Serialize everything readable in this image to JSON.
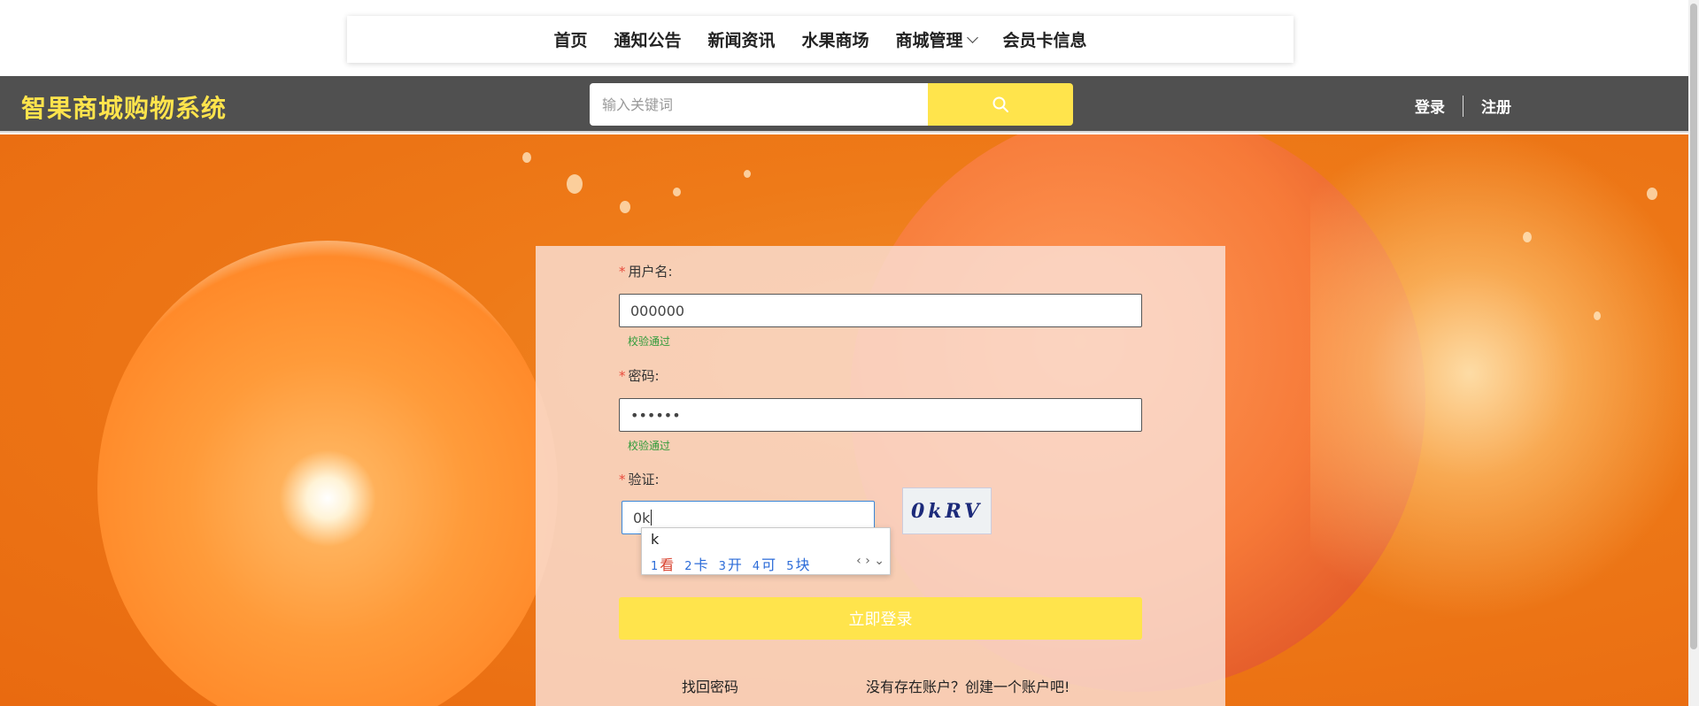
{
  "nav": {
    "items": [
      {
        "label": "首页"
      },
      {
        "label": "通知公告"
      },
      {
        "label": "新闻资讯"
      },
      {
        "label": "水果商场"
      },
      {
        "label": "商城管理",
        "has_dropdown": true
      },
      {
        "label": "会员卡信息"
      }
    ]
  },
  "header": {
    "brand": "智果商城购物系统",
    "search_placeholder": "输入关键词",
    "search_icon": "search-icon",
    "login": "登录",
    "register": "注册"
  },
  "form": {
    "username": {
      "label": "用户名:",
      "value": "000000",
      "status": "校验通过"
    },
    "password": {
      "label": "密码:",
      "value": "••••••",
      "status": "校验通过"
    },
    "captcha": {
      "label": "验证:",
      "value": "0k",
      "image_text": "0kRV"
    },
    "submit": "立即登录",
    "forgot": "找回密码",
    "register_prompt": "没有存在账户？创建一个账户吧!"
  },
  "ime": {
    "composition": "k",
    "candidates": [
      {
        "n": "1",
        "w": "看"
      },
      {
        "n": "2",
        "w": "卡"
      },
      {
        "n": "3",
        "w": "开"
      },
      {
        "n": "4",
        "w": "可"
      },
      {
        "n": "5",
        "w": "块"
      }
    ]
  },
  "colors": {
    "accent": "#ffe44c",
    "header_bg": "#505050",
    "success": "#2e9b3a",
    "required": "#e84c3d"
  }
}
